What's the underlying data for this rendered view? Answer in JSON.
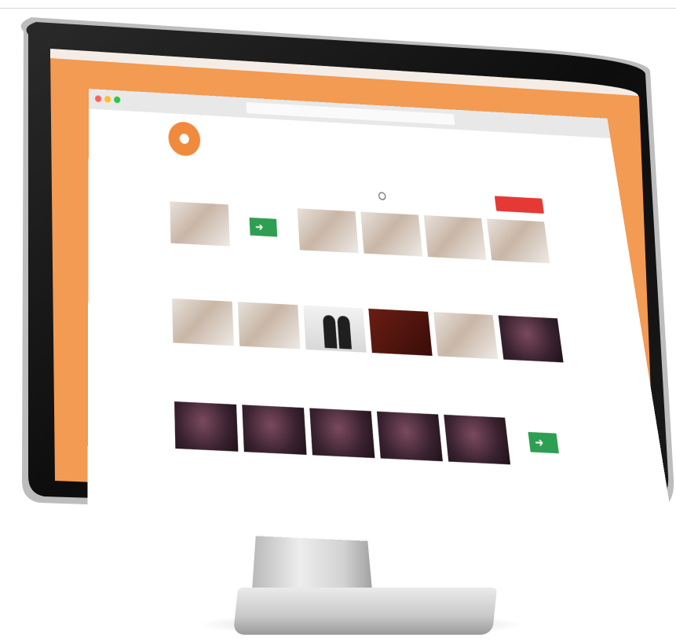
{
  "scene": {
    "colors": {
      "wallpaper": "#F39A53",
      "bezel": "#111111",
      "accent": "#E53935",
      "avatar": "#F08A3C"
    }
  },
  "browser": {
    "url": ""
  },
  "channel": {
    "name": "",
    "subscribers": "",
    "subscribe_label": "",
    "tabs": [
      "",
      "",
      "",
      "",
      "",
      ""
    ],
    "sort_label": "",
    "sort_value": "",
    "uploads_label": ""
  },
  "videos": [
    {
      "thumb": "hand"
    },
    {
      "thumb": "sign"
    },
    {
      "thumb": "hand"
    },
    {
      "thumb": "hand"
    },
    {
      "thumb": "hand"
    },
    {
      "thumb": "hand"
    },
    {
      "thumb": "hand"
    },
    {
      "thumb": "hand"
    },
    {
      "thumb": "people"
    },
    {
      "thumb": "box"
    },
    {
      "thumb": "hand"
    },
    {
      "thumb": "dark"
    },
    {
      "thumb": "dark"
    },
    {
      "thumb": "dark"
    },
    {
      "thumb": "dark"
    },
    {
      "thumb": "dark"
    },
    {
      "thumb": "dark"
    },
    {
      "thumb": "sign"
    }
  ]
}
